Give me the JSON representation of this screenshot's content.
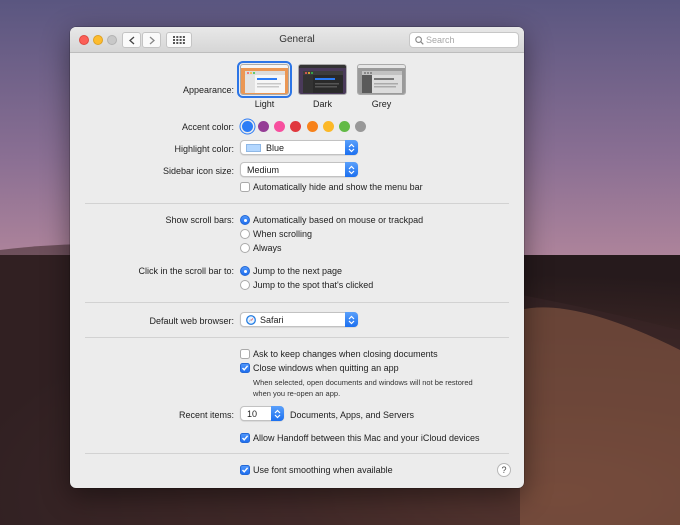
{
  "window": {
    "title": "General"
  },
  "search": {
    "placeholder": "Search"
  },
  "appearance": {
    "label": "Appearance:",
    "options": [
      {
        "name": "Light",
        "selected": true
      },
      {
        "name": "Dark",
        "selected": false
      },
      {
        "name": "Grey",
        "selected": false
      }
    ]
  },
  "accent": {
    "label": "Accent color:",
    "colors": [
      "#2c7cf6",
      "#953d96",
      "#f74f9e",
      "#e0383e",
      "#f7821b",
      "#fcb827",
      "#62ba46",
      "#989898"
    ],
    "selected_index": 0
  },
  "highlight": {
    "label": "Highlight color:",
    "value": "Blue",
    "swatch": "#b3d7ff"
  },
  "sidebar_icon": {
    "label": "Sidebar icon size:",
    "value": "Medium"
  },
  "menu_bar": {
    "label": "Automatically hide and show the menu bar",
    "checked": false
  },
  "scroll_bars": {
    "label": "Show scroll bars:",
    "options": [
      {
        "label": "Automatically based on mouse or trackpad",
        "selected": true
      },
      {
        "label": "When scrolling",
        "selected": false
      },
      {
        "label": "Always",
        "selected": false
      }
    ]
  },
  "scroll_click": {
    "label": "Click in the scroll bar to:",
    "options": [
      {
        "label": "Jump to the next page",
        "selected": true
      },
      {
        "label": "Jump to the spot that's clicked",
        "selected": false
      }
    ]
  },
  "browser": {
    "label": "Default web browser:",
    "value": "Safari"
  },
  "ask_changes": {
    "label": "Ask to keep changes when closing documents",
    "checked": false
  },
  "close_windows": {
    "label": "Close windows when quitting an app",
    "checked": true,
    "note_line1": "When selected, open documents and windows will not be restored",
    "note_line2": "when you re-open an app."
  },
  "recent_items": {
    "label": "Recent items:",
    "value": "10",
    "suffix": "Documents, Apps, and Servers"
  },
  "handoff": {
    "label": "Allow Handoff between this Mac and your iCloud devices",
    "checked": true
  },
  "font_smoothing": {
    "label": "Use font smoothing when available",
    "checked": true
  },
  "help": {
    "label": "?"
  }
}
